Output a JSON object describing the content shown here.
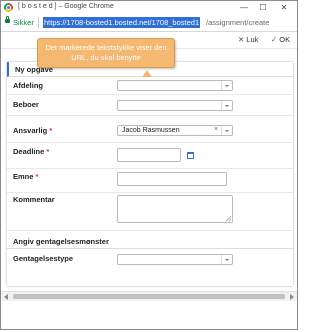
{
  "window": {
    "title": "[ b o s t e d ] – Google Chrome",
    "minimize": "—",
    "maximize": "☐",
    "close": "✕"
  },
  "address": {
    "secure_label": "Sikker",
    "url_selected": "https://1708-bosted1.bosted.net/1708_bosted1",
    "url_rest": "/assignment/create"
  },
  "toolbar": {
    "close_label": "Luk",
    "ok_label": "OK"
  },
  "callout": {
    "line1": "Det markerede tekststykke viser den",
    "line2": "URL, du skal benytte"
  },
  "form": {
    "section_title": "Ny opgave",
    "fields": {
      "afdeling": "Afdeling",
      "beboer": "Beboer",
      "ansvarlig": "Ansvarlig",
      "ansvarlig_value": "Jacob Rasmussen",
      "deadline": "Deadline",
      "emne": "Emne",
      "kommentar": "Kommentar"
    },
    "required_mark": "*",
    "clear_mark": "×",
    "repeat_section_title": "Angiv gentagelsesmønster",
    "repeat_type_label": "Gentagelsestype"
  }
}
